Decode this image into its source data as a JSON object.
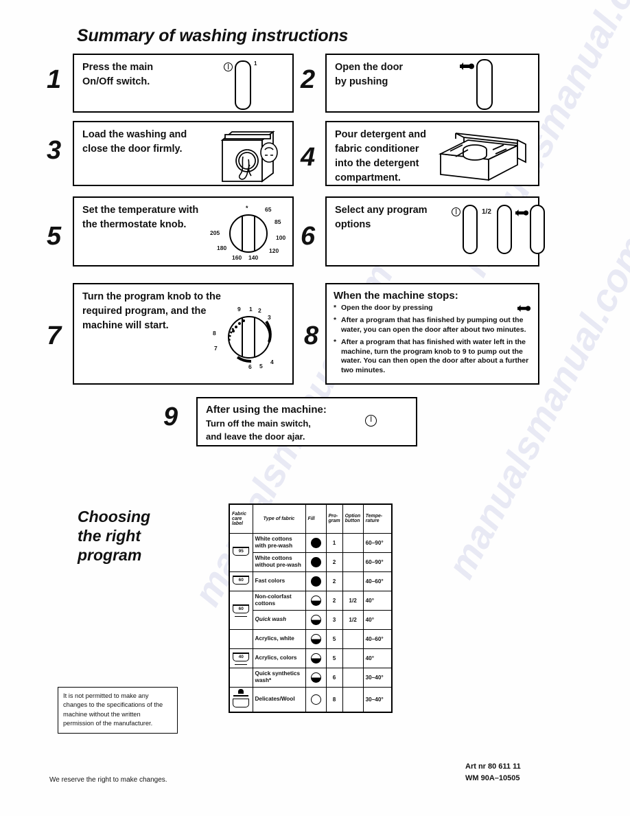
{
  "document": {
    "title": "Summary of washing instructions",
    "watermark": "manualsmanual.com"
  },
  "steps": [
    {
      "number": "1",
      "text": "Press the main\nOn/Off switch.",
      "icon": "on-off-switch-button",
      "symbols": [
        "power-symbol",
        "1"
      ]
    },
    {
      "number": "2",
      "text": "Open the door\nby pushing",
      "icon": "door-push-button",
      "symbols": [
        "door-push-symbol"
      ]
    },
    {
      "number": "3",
      "text": "Load the washing and\nclose the door firmly.",
      "icon": "washing-machine-loading-illustration",
      "symbols": []
    },
    {
      "number": "4",
      "text": "Pour detergent and\nfabric conditioner\ninto the detergent\ncompartment.",
      "icon": "detergent-drawer-illustration",
      "symbols": []
    },
    {
      "number": "5",
      "text": "Set the temperature with\nthe thermostate knob.",
      "icon": "thermostat-knob",
      "symbols": []
    },
    {
      "number": "6",
      "text": "Select any program\noptions",
      "icon": "option-buttons",
      "symbols": [
        "power-symbol",
        "1/2",
        "door-push-symbol"
      ]
    },
    {
      "number": "7",
      "text": "Turn the program knob to the\nrequired program, and the\nmachine will start.",
      "icon": "program-knob",
      "symbols": []
    },
    {
      "number": "8",
      "text": "When the machine stops:",
      "icon": "door-push-symbol",
      "symbols": []
    },
    {
      "number": "9",
      "text": "After using the machine:",
      "icon": "power-symbol",
      "symbols": []
    }
  ],
  "step8": {
    "title": "When the machine stops:",
    "bullets": [
      "Open the door by pressing",
      "After a program that has finished by pumping out the water, you can open the door after about two minutes.",
      "After a program that has finished with water left in the machine, turn the program knob to 9 to pump out the water. You can then open the door after about a further two minutes."
    ],
    "bullet_marker": "*"
  },
  "step9": {
    "title": "After using the machine:",
    "body": "Turn off the main switch,\nand leave the door ajar."
  },
  "thermostat_knob": {
    "name": "thermostate-knob",
    "labels": [
      "65",
      "85",
      "100",
      "120",
      "140",
      "160",
      "180",
      "205"
    ],
    "marker": "*"
  },
  "program_knob": {
    "name": "program-knob",
    "labels": [
      "9",
      "1",
      "2",
      "3",
      "4",
      "5",
      "6",
      "7",
      "8"
    ]
  },
  "choosing": {
    "title": "Choosing\nthe right\nprogram"
  },
  "chart_data": {
    "type": "table",
    "title": "Choosing the right program",
    "columns": [
      "Fabric care label",
      "Type of fabric",
      "Fill",
      "Pro-gram",
      "Option button",
      "Tempe-rature"
    ],
    "rows": [
      {
        "care_label": "wash-tub-95",
        "care_label_text": "95",
        "care_label_rowspan": 2,
        "fabric": "White cottons with pre-wash",
        "fill": "full",
        "program": "1",
        "option": "",
        "temperature": "60–90°",
        "italic": false
      },
      {
        "care_label": null,
        "fabric": "White cottons without pre-wash",
        "fill": "full",
        "program": "2",
        "option": "",
        "temperature": "60–90°",
        "italic": false
      },
      {
        "care_label": "wash-tub-60",
        "care_label_text": "60",
        "care_label_rowspan": 1,
        "fabric": "Fast colors",
        "fill": "full",
        "program": "2",
        "option": "",
        "temperature": "40–60°",
        "italic": false
      },
      {
        "care_label": "wash-tub-60-bar",
        "care_label_text": "60",
        "care_label_rowspan": 2,
        "fabric": "Non-colorfast cottons",
        "fill": "half",
        "program": "2",
        "option": "1/2",
        "temperature": "40°",
        "italic": false
      },
      {
        "care_label": null,
        "fabric": "Quick wash",
        "fill": "half",
        "program": "3",
        "option": "1/2",
        "temperature": "40°",
        "italic": true
      },
      {
        "care_label": "",
        "fabric": "Acrylics, white",
        "fill": "half",
        "program": "5",
        "option": "",
        "temperature": "40–60°",
        "italic": false
      },
      {
        "care_label": "wash-tub-40-bar",
        "care_label_text": "40",
        "care_label_rowspan": 1,
        "fabric": "Acrylics, colors",
        "fill": "half",
        "program": "5",
        "option": "",
        "temperature": "40°",
        "italic": false
      },
      {
        "care_label": "",
        "fabric": "Quick synthetics wash*",
        "fill": "half",
        "program": "6",
        "option": "",
        "temperature": "30–40°",
        "italic": false
      },
      {
        "care_label": "hand-wash",
        "care_label_text": "",
        "care_label_rowspan": 1,
        "fabric": "Delicates/Wool",
        "fill": "empty",
        "program": "8",
        "option": "",
        "temperature": "30–40°",
        "italic": false
      }
    ]
  },
  "notice": {
    "text": "It is not permitted to make any changes to the specifications of the machine without the written permission of the manufacturer."
  },
  "footer": {
    "left": "We reserve the right to make changes.",
    "right": "Art nr 80 611 11\nWM 90A–10505"
  }
}
